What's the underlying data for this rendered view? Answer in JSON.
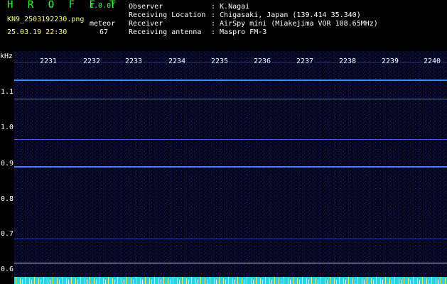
{
  "header": {
    "title": "H R O F F T",
    "version": "1.0.0f",
    "filename": "KN9_2503192230.png",
    "datetime": "25.03.19 22:30",
    "tag": "meteor",
    "count": "67",
    "info": [
      {
        "label": "Observer",
        "value": ": K.Nagai"
      },
      {
        "label": "Receiving Location",
        "value": ": Chigasaki, Japan (139.414 35.340)"
      },
      {
        "label": "Receiver",
        "value": ": AirSpy mini (Miakejima VOR 108.65MHz)"
      },
      {
        "label": "Receiving antenna",
        "value": ": Maspro FM-3"
      }
    ]
  },
  "axis": {
    "unit": "kHz",
    "y_labels": [
      "1.1",
      "1.0",
      "0.9",
      "0.8",
      "0.7",
      "0.6"
    ],
    "time_ticks": [
      "2231",
      "2232",
      "2233",
      "2234",
      "2235",
      "2236",
      "2237",
      "2238",
      "2239",
      "2240"
    ]
  },
  "colors": {
    "signal": "#4a7dff",
    "weak": "#2d4fd0",
    "white_line": "#cfd6ff",
    "noise": "#1a1a66",
    "bottom": "#2ad0e8"
  }
}
